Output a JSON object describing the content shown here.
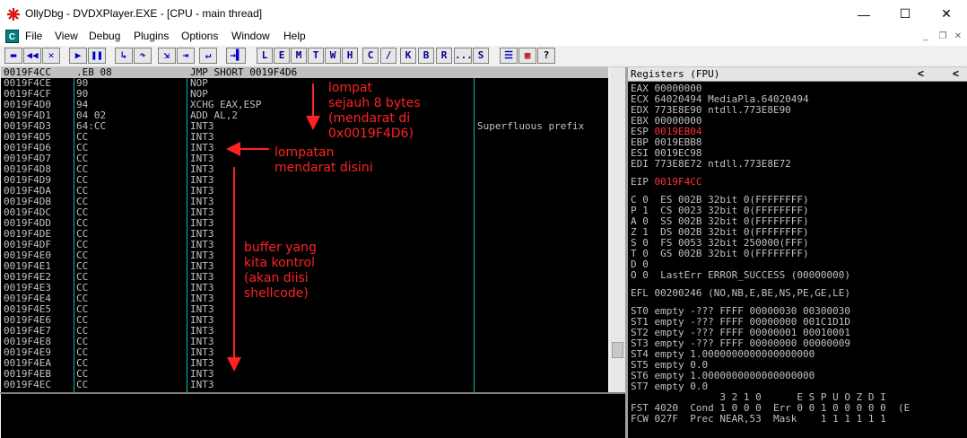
{
  "window": {
    "title": "OllyDbg - DVDXPlayer.EXE - [CPU - main thread]",
    "controls": {
      "minimize": "—",
      "maximize": "☐",
      "close": "✕"
    }
  },
  "menu": {
    "mdi_icon": "C",
    "items": [
      "File",
      "View",
      "Debug",
      "Plugins",
      "Options",
      "Window",
      "Help"
    ],
    "mdi_controls": {
      "minimize": "_",
      "restore": "❐",
      "close": "✕"
    }
  },
  "toolbar": {
    "icons": [
      "open-icon",
      "rewind-icon",
      "close-icon",
      "run-icon",
      "pause-icon",
      "step-into-icon",
      "step-over-icon",
      "trace-into-icon",
      "trace-over-icon",
      "execute-till-return-icon",
      "go-to-icon"
    ],
    "glyphs": [
      "▬",
      "◀◀",
      "✕",
      "▶",
      "❚❚",
      "↳",
      "↷",
      "⇲",
      "⇥",
      "↵",
      "→▌"
    ],
    "letters": [
      "L",
      "E",
      "M",
      "T",
      "W",
      "H",
      "C",
      "/",
      "K",
      "B",
      "R",
      "...",
      "S"
    ],
    "extra_glyphs": [
      "☰",
      "▦",
      "?"
    ]
  },
  "cpu": {
    "rows": [
      {
        "addr": "0019F4CC",
        "hex": ".EB 08",
        "disasm": "JMP SHORT 0019F4D6",
        "comment": "",
        "selected": true
      },
      {
        "addr": "0019F4CE",
        "hex": "90",
        "disasm": "NOP",
        "comment": ""
      },
      {
        "addr": "0019F4CF",
        "hex": "90",
        "disasm": "NOP",
        "comment": ""
      },
      {
        "addr": "0019F4D0",
        "hex": "94",
        "disasm": "XCHG EAX,ESP",
        "comment": ""
      },
      {
        "addr": "0019F4D1",
        "hex": "04 02",
        "disasm": "ADD AL,2",
        "comment": ""
      },
      {
        "addr": "0019F4D3",
        "hex": "64:CC",
        "disasm": "INT3",
        "comment": "Superfluous prefix"
      },
      {
        "addr": "0019F4D5",
        "hex": "CC",
        "disasm": "INT3",
        "comment": ""
      },
      {
        "addr": "0019F4D6",
        "hex": "CC",
        "disasm": "INT3",
        "comment": ""
      },
      {
        "addr": "0019F4D7",
        "hex": "CC",
        "disasm": "INT3",
        "comment": ""
      },
      {
        "addr": "0019F4D8",
        "hex": "CC",
        "disasm": "INT3",
        "comment": ""
      },
      {
        "addr": "0019F4D9",
        "hex": "CC",
        "disasm": "INT3",
        "comment": ""
      },
      {
        "addr": "0019F4DA",
        "hex": "CC",
        "disasm": "INT3",
        "comment": ""
      },
      {
        "addr": "0019F4DB",
        "hex": "CC",
        "disasm": "INT3",
        "comment": ""
      },
      {
        "addr": "0019F4DC",
        "hex": "CC",
        "disasm": "INT3",
        "comment": ""
      },
      {
        "addr": "0019F4DD",
        "hex": "CC",
        "disasm": "INT3",
        "comment": ""
      },
      {
        "addr": "0019F4DE",
        "hex": "CC",
        "disasm": "INT3",
        "comment": ""
      },
      {
        "addr": "0019F4DF",
        "hex": "CC",
        "disasm": "INT3",
        "comment": ""
      },
      {
        "addr": "0019F4E0",
        "hex": "CC",
        "disasm": "INT3",
        "comment": ""
      },
      {
        "addr": "0019F4E1",
        "hex": "CC",
        "disasm": "INT3",
        "comment": ""
      },
      {
        "addr": "0019F4E2",
        "hex": "CC",
        "disasm": "INT3",
        "comment": ""
      },
      {
        "addr": "0019F4E3",
        "hex": "CC",
        "disasm": "INT3",
        "comment": ""
      },
      {
        "addr": "0019F4E4",
        "hex": "CC",
        "disasm": "INT3",
        "comment": ""
      },
      {
        "addr": "0019F4E5",
        "hex": "CC",
        "disasm": "INT3",
        "comment": ""
      },
      {
        "addr": "0019F4E6",
        "hex": "CC",
        "disasm": "INT3",
        "comment": ""
      },
      {
        "addr": "0019F4E7",
        "hex": "CC",
        "disasm": "INT3",
        "comment": ""
      },
      {
        "addr": "0019F4E8",
        "hex": "CC",
        "disasm": "INT3",
        "comment": ""
      },
      {
        "addr": "0019F4E9",
        "hex": "CC",
        "disasm": "INT3",
        "comment": ""
      },
      {
        "addr": "0019F4EA",
        "hex": "CC",
        "disasm": "INT3",
        "comment": ""
      },
      {
        "addr": "0019F4EB",
        "hex": "CC",
        "disasm": "INT3",
        "comment": ""
      },
      {
        "addr": "0019F4EC",
        "hex": "CC",
        "disasm": "INT3",
        "comment": ""
      }
    ]
  },
  "annotations": {
    "jump": [
      "lompat",
      "sejauh 8 bytes",
      "(mendarat di",
      "0x0019F4D6)"
    ],
    "landing": [
      "lompatan",
      "mendarat disini"
    ],
    "buffer": [
      "buffer yang",
      "kita kontrol",
      "(akan diisi",
      "shellcode)"
    ]
  },
  "registers": {
    "title": "Registers (FPU)",
    "nav": [
      "<",
      "<"
    ],
    "lines": [
      {
        "t": "EAX 00000000"
      },
      {
        "t": "ECX 64020494 MediaPla.64020494"
      },
      {
        "t": "EDX 773E8E90 ntdll.773E8E90"
      },
      {
        "t": "EBX 00000000"
      },
      {
        "t": "ESP ",
        "v": "0019EB04",
        "red": true
      },
      {
        "t": "EBP 0019EBB8"
      },
      {
        "t": "ESI 0019EC98"
      },
      {
        "t": "EDI 773E8E72 ntdll.773E8E72"
      },
      {
        "t": ""
      },
      {
        "t": "EIP ",
        "v": "0019F4CC",
        "red": true
      },
      {
        "t": ""
      },
      {
        "t": "C 0  ES 002B 32bit 0(FFFFFFFF)"
      },
      {
        "t": "P 1  CS 0023 32bit 0(FFFFFFFF)"
      },
      {
        "t": "A 0  SS 002B 32bit 0(FFFFFFFF)"
      },
      {
        "t": "Z 1  DS 002B 32bit 0(FFFFFFFF)"
      },
      {
        "t": "S 0  FS 0053 32bit 250000(FFF)"
      },
      {
        "t": "T 0  GS 002B 32bit 0(FFFFFFFF)"
      },
      {
        "t": "D 0"
      },
      {
        "t": "O 0  LastErr ERROR_SUCCESS (00000000)"
      },
      {
        "t": ""
      },
      {
        "t": "EFL 00200246 (NO,NB,E,BE,NS,PE,GE,LE)"
      },
      {
        "t": ""
      },
      {
        "t": "ST0 empty -??? FFFF 00000030 00300030"
      },
      {
        "t": "ST1 empty -??? FFFF 00000000 001C1D1D"
      },
      {
        "t": "ST2 empty -??? FFFF 00000001 00010001"
      },
      {
        "t": "ST3 empty -??? FFFF 00000000 00000009"
      },
      {
        "t": "ST4 empty 1.0000000000000000000"
      },
      {
        "t": "ST5 empty 0.0"
      },
      {
        "t": "ST6 empty 1.0000000000000000000"
      },
      {
        "t": "ST7 empty 0.0"
      },
      {
        "t": "               3 2 1 0      E S P U O Z D I"
      },
      {
        "t": "FST 4020  Cond 1 0 0 0  Err 0 0 1 0 0 0 0 0  (E"
      },
      {
        "t": "FCW 027F  Prec NEAR,53  Mask    1 1 1 1 1 1"
      }
    ]
  },
  "colors": {
    "accent_red": "#ff2222",
    "register_changed": "#ff3030",
    "column_divider": "#00bcbc"
  }
}
